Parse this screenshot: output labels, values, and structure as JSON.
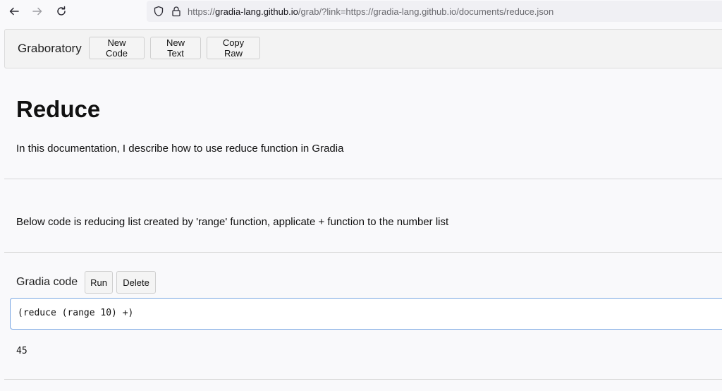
{
  "browser": {
    "url_scheme": "https://",
    "url_host": "gradia-lang.github.io",
    "url_rest": "/grab/?link=https://gradia-lang.github.io/documents/reduce.json"
  },
  "navbar": {
    "brand": "Graboratory",
    "new_code_label": "New Code",
    "new_text_label": "New Text",
    "copy_raw_label": "Copy Raw"
  },
  "document": {
    "title": "Reduce",
    "intro": "In this documentation, I describe how to use reduce function in Gradia",
    "description": "Below code is reducing list created by 'range' function, applicate + function to the number list"
  },
  "code_block": {
    "label": "Gradia code",
    "run_label": "Run",
    "delete_label": "Delete",
    "code": "(reduce (range 10) +)",
    "output": "45"
  }
}
